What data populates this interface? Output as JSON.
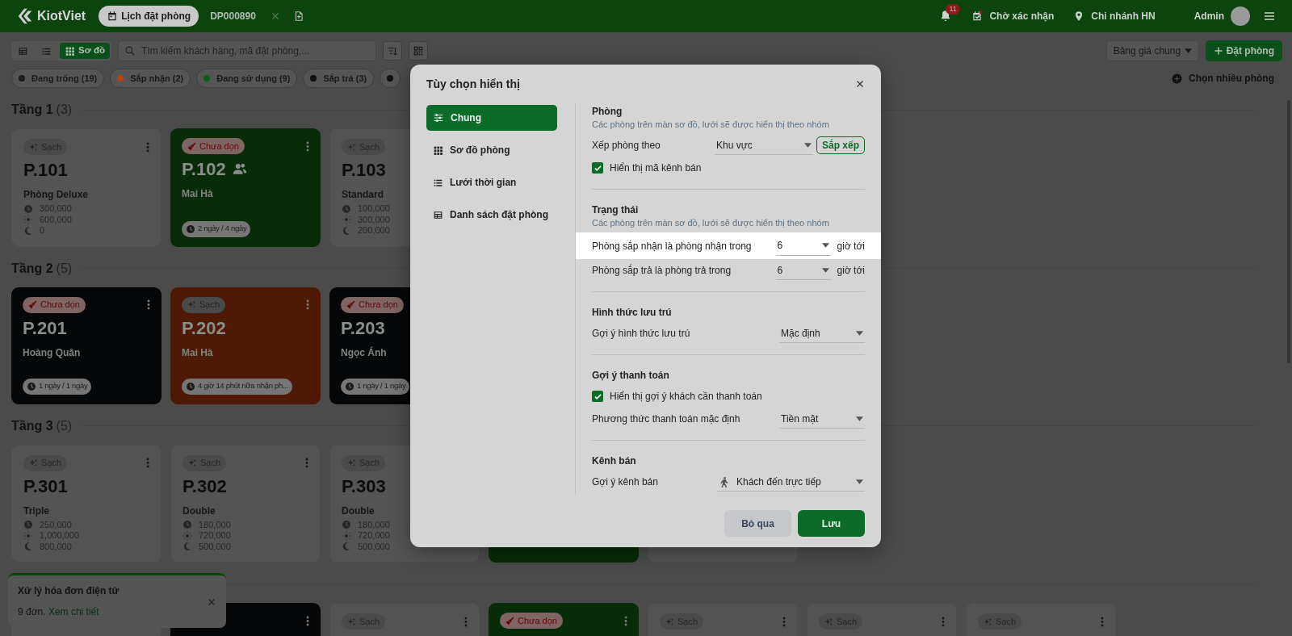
{
  "header": {
    "logo": "KiotViet",
    "tabs": [
      {
        "kind": "page",
        "label": "Lịch đặt phòng",
        "selected": true
      },
      {
        "kind": "booking",
        "label": "DP000890",
        "selected": false
      }
    ],
    "notifications": "11",
    "pending": "Chờ xác nhận",
    "branch": "Chi nhánh HN",
    "user": "Admin"
  },
  "toolbar": {
    "views": [
      {
        "kind": "table",
        "selected": false
      },
      {
        "kind": "list",
        "selected": false
      },
      {
        "kind": "grid",
        "label": "Sơ đồ",
        "selected": true
      }
    ],
    "search": {
      "placeholder": "Tìm kiếm khách hàng, mã đặt phòng,..."
    },
    "price_list": "Bảng giá chung",
    "book_button": "Đặt phòng",
    "multi_select": "Chọn nhiều phòng"
  },
  "status_filters": [
    {
      "label": "Đang trống (19)",
      "color": "#1c1c1c"
    },
    {
      "label": "Sắp nhận (2)",
      "color": "#b8400f"
    },
    {
      "label": "Đang sử dụng (9)",
      "color": "#0d5c1c"
    },
    {
      "label": "Sắp trả (3)",
      "color": "#101010"
    },
    {
      "color": "#101010"
    }
  ],
  "floors": [
    {
      "title": "Tầng 1",
      "count": "(3)",
      "rooms": [
        {
          "tag": {
            "kind": "clean",
            "label": "Sạch"
          },
          "name": "P.101",
          "kind": "vacant",
          "subtitle": "Phòng Deluxe",
          "prices": [
            {
              "kind": "hour",
              "value": "300,000"
            },
            {
              "kind": "day",
              "value": "600,000"
            },
            {
              "kind": "night",
              "value": "0"
            }
          ]
        },
        {
          "tag": {
            "kind": "dirty",
            "label": "Chưa dọn"
          },
          "name": "P.102",
          "kind": "occupied",
          "group": true,
          "subtitle": "Mai Hà",
          "duration": "2 ngày / 4 ngày"
        },
        {
          "tag": {
            "kind": "clean",
            "label": "Sạch"
          },
          "name": "P.103",
          "kind": "vacant",
          "subtitle": "Standard",
          "prices": [
            {
              "kind": "hour",
              "value": "100,000"
            },
            {
              "kind": "day",
              "value": "300,000"
            },
            {
              "kind": "night",
              "value": "200,000"
            }
          ]
        }
      ]
    },
    {
      "title": "Tầng 2",
      "count": "(5)",
      "rooms": [
        {
          "tag": {
            "kind": "dirty",
            "label": "Chưa dọn"
          },
          "name": "P.201",
          "kind": "checkout",
          "subtitle": "Hoàng Quân",
          "duration": "1 ngày / 1 ngày"
        },
        {
          "tag": {
            "kind": "clean",
            "label": "Sạch"
          },
          "name": "P.202",
          "kind": "arriving",
          "subtitle": "Mai Hà",
          "duration": "4 giờ 14 phút nữa nhận ph..."
        },
        {
          "tag": {
            "kind": "dirty",
            "label": "Chưa dọn"
          },
          "name": "P.203",
          "kind": "checkout",
          "subtitle": "Ngọc Ánh",
          "duration": "1 ngày / 1 ngày"
        }
      ]
    },
    {
      "title": "Tầng 3",
      "count": "(5)",
      "rooms": [
        {
          "tag": {
            "kind": "clean",
            "label": "Sạch"
          },
          "name": "P.301",
          "kind": "vacant",
          "subtitle": "Triple",
          "prices": [
            {
              "kind": "hour",
              "value": "250,000"
            },
            {
              "kind": "day",
              "value": "1,000,000"
            },
            {
              "kind": "night",
              "value": "800,000"
            }
          ]
        },
        {
          "tag": {
            "kind": "clean",
            "label": "Sạch"
          },
          "name": "P.302",
          "kind": "vacant",
          "subtitle": "Double",
          "prices": [
            {
              "kind": "hour",
              "value": "180,000"
            },
            {
              "kind": "day",
              "value": "720,000"
            },
            {
              "kind": "night",
              "value": "500,000"
            }
          ]
        },
        {
          "tag": {
            "kind": "clean",
            "label": "Sạch"
          },
          "name": "P.303",
          "kind": "vacant",
          "subtitle": "Double",
          "prices": [
            {
              "kind": "hour",
              "value": "180,000"
            },
            {
              "kind": "day",
              "value": "720,000"
            },
            {
              "kind": "night",
              "value": "500,000"
            }
          ]
        },
        {
          "kind": "occupied"
        },
        {
          "kind": "vacant"
        }
      ]
    },
    {
      "rooms": [
        {
          "kind": "vacant"
        },
        {
          "kind": "checkout"
        },
        {
          "tag": {
            "kind": "clean",
            "label": "Sạch"
          },
          "kind": "vacant"
        },
        {
          "tag": {
            "kind": "dirty",
            "label": "Chưa dọn"
          },
          "kind": "occupied"
        },
        {
          "tag": {
            "kind": "clean",
            "label": "Sạch"
          },
          "kind": "vacant"
        },
        {
          "tag": {
            "kind": "clean",
            "label": "Sạch"
          },
          "kind": "vacant"
        },
        {
          "tag": {
            "kind": "clean",
            "label": "Sạch"
          },
          "kind": "vacant"
        }
      ]
    }
  ],
  "toast": {
    "title": "Xử lý hóa đơn điện tử",
    "text": "9 đơn.",
    "link": "Xem chi tiết"
  },
  "modal": {
    "title": "Tùy chọn hiển thị",
    "nav": [
      {
        "kind": "general",
        "label": "Chung",
        "selected": true
      },
      {
        "kind": "map",
        "label": "Sơ đồ phòng",
        "selected": false
      },
      {
        "kind": "timeline",
        "label": "Lưới thời gian",
        "selected": false
      },
      {
        "kind": "bookings",
        "label": "Danh sách đặt phòng",
        "selected": false
      }
    ],
    "sections": [
      {
        "title": "Phòng",
        "description": "Các phòng trên màn sơ đồ, lưới sẽ được hiển thị theo nhóm",
        "rows": [
          {
            "kind": "select",
            "label": "Xếp phòng theo",
            "value": "Khu vực",
            "button": "Sắp xếp",
            "highlighted": false
          },
          {
            "kind": "checkbox",
            "label": "Hiển thị mã kênh bán",
            "checked": true
          }
        ]
      },
      {
        "title": "Trạng thái",
        "description": "Các phòng trên màn sơ đồ, lưới sẽ được hiển thị theo nhóm",
        "rows": [
          {
            "kind": "select",
            "label": "Phòng sắp nhận là phòng nhận trong",
            "value": "6",
            "suffix": "giờ tới",
            "highlighted": true
          },
          {
            "kind": "select",
            "label": "Phòng sắp trả là phòng trả trong",
            "value": "6",
            "suffix": "giờ tới",
            "highlighted": false
          }
        ]
      },
      {
        "title": "Hình thức lưu trú",
        "rows": [
          {
            "kind": "select",
            "label": "Gợi ý hình thức lưu trú",
            "value": "Mặc định",
            "highlighted": false
          }
        ]
      },
      {
        "title": "Gợi ý thanh toán",
        "rows": [
          {
            "kind": "checkbox",
            "label": "Hiển thị gợi ý khách cần thanh toán",
            "checked": true
          },
          {
            "kind": "select",
            "label": "Phương thức thanh toán mặc định",
            "value": "Tiền mặt",
            "highlighted": false
          }
        ]
      },
      {
        "title": "Kênh bán",
        "rows": [
          {
            "kind": "channel_select",
            "label": "Gợi ý kênh bán",
            "value": "Khách đến trực tiếp",
            "highlighted": false
          }
        ]
      }
    ],
    "buttons": [
      {
        "kind": "secondary",
        "label": "Bỏ qua"
      },
      {
        "kind": "primary",
        "label": "Lưu"
      }
    ]
  }
}
